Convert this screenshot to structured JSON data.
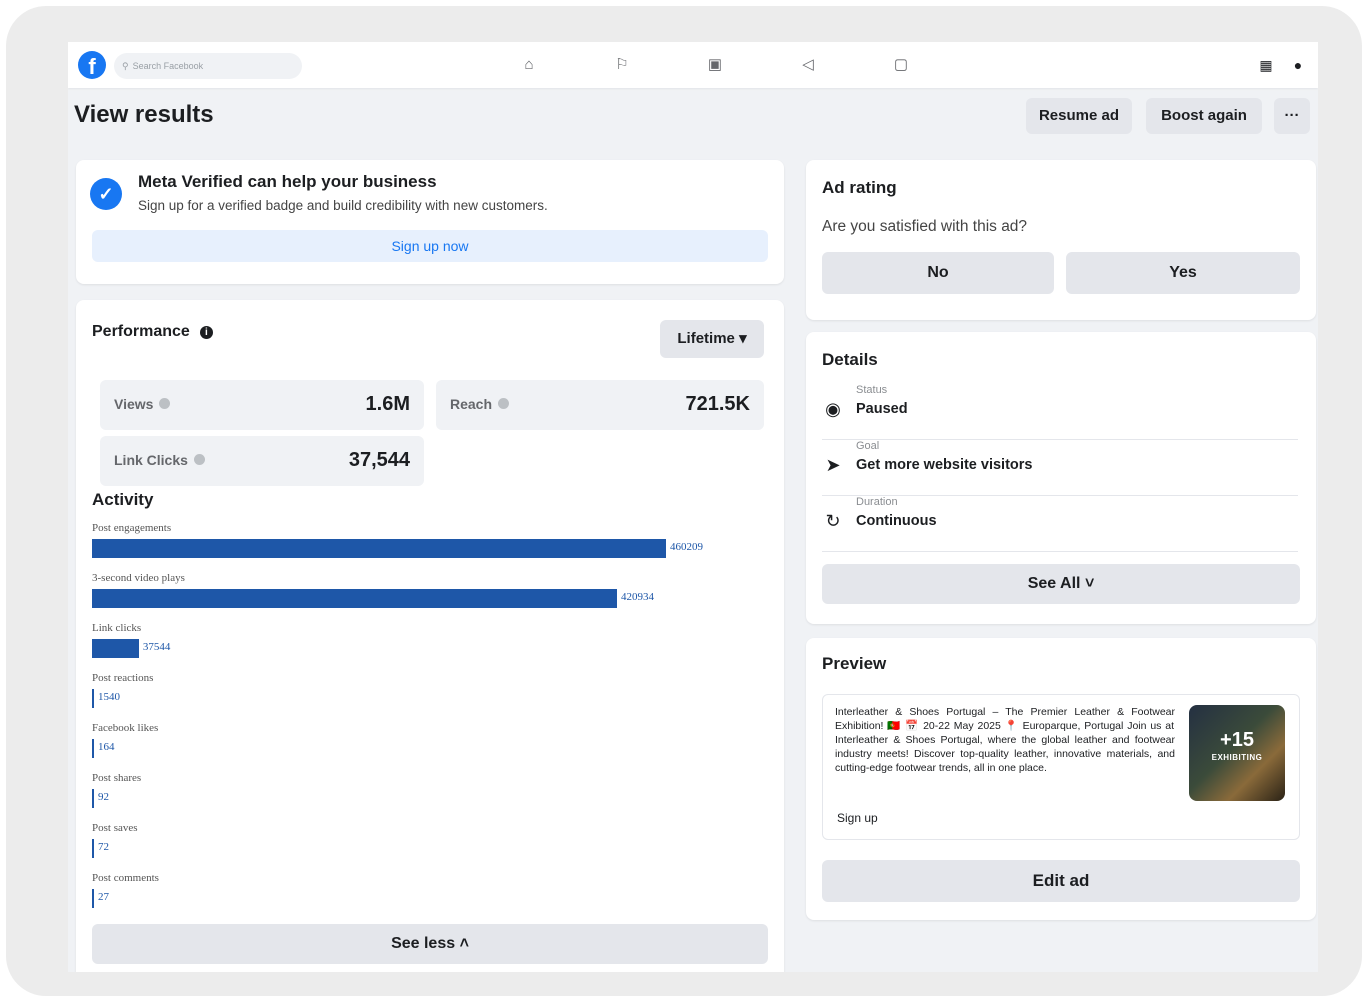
{
  "nav": {
    "logo": "f",
    "search_placeholder": "Search Facebook",
    "icons": [
      "home-icon",
      "flag-icon",
      "video-icon",
      "megaphone-icon",
      "gaming-icon"
    ],
    "right_icons": [
      "grid-menu-icon",
      "profile-icon"
    ]
  },
  "header": {
    "title": "View results",
    "resume_label": "Resume ad",
    "boost_label": "Boost again",
    "more_label": "···"
  },
  "meta_verified": {
    "title": "Meta Verified can help your business",
    "subtitle": "Sign up for a verified badge and build credibility with new customers.",
    "button": "Sign up now"
  },
  "performance": {
    "title": "Performance",
    "range": "Lifetime",
    "stats": [
      {
        "label": "Views",
        "value": "1.6M"
      },
      {
        "label": "Reach",
        "value": "721.5K"
      },
      {
        "label": "Link Clicks",
        "value": "37,544"
      }
    ],
    "activity_title": "Activity",
    "activity": [
      {
        "label": "Post engagements",
        "value": 460209
      },
      {
        "label": "3-second video plays",
        "value": 420934
      },
      {
        "label": "Link clicks",
        "value": 37544
      },
      {
        "label": "Post reactions",
        "value": 1540
      },
      {
        "label": "Facebook likes",
        "value": 164
      },
      {
        "label": "Post shares",
        "value": 92
      },
      {
        "label": "Post saves",
        "value": 72
      },
      {
        "label": "Post comments",
        "value": 27
      }
    ],
    "see_less": "See less"
  },
  "ad_rating": {
    "title": "Ad rating",
    "question": "Are you satisfied with this ad?",
    "no": "No",
    "yes": "Yes"
  },
  "details": {
    "title": "Details",
    "rows": [
      {
        "small": "Status",
        "value": "Paused",
        "icon": "radio-icon"
      },
      {
        "small": "Goal",
        "value": "Get more website visitors",
        "icon": "cursor-icon"
      },
      {
        "small": "Duration",
        "value": "Continuous",
        "icon": "refresh-icon"
      }
    ],
    "see_all": "See All"
  },
  "preview": {
    "title": "Preview",
    "text": "Interleather & Shoes Portugal – The Premier Leather & Footwear Exhibition! 🇵🇹 📅 20-22 May 2025 📍 Europarque, Portugal Join us at Interleather & Shoes Portugal, where the global leather and footwear industry meets! Discover top-quality leather, innovative materials, and cutting-edge footwear trends, all in one place.",
    "cta": "Sign up",
    "thumb_count": "+15",
    "thumb_caption": "EXHIBITING",
    "edit": "Edit ad"
  },
  "colors": {
    "accent": "#1877f2",
    "bar": "#1e57a8",
    "background": "#f0f2f5"
  }
}
